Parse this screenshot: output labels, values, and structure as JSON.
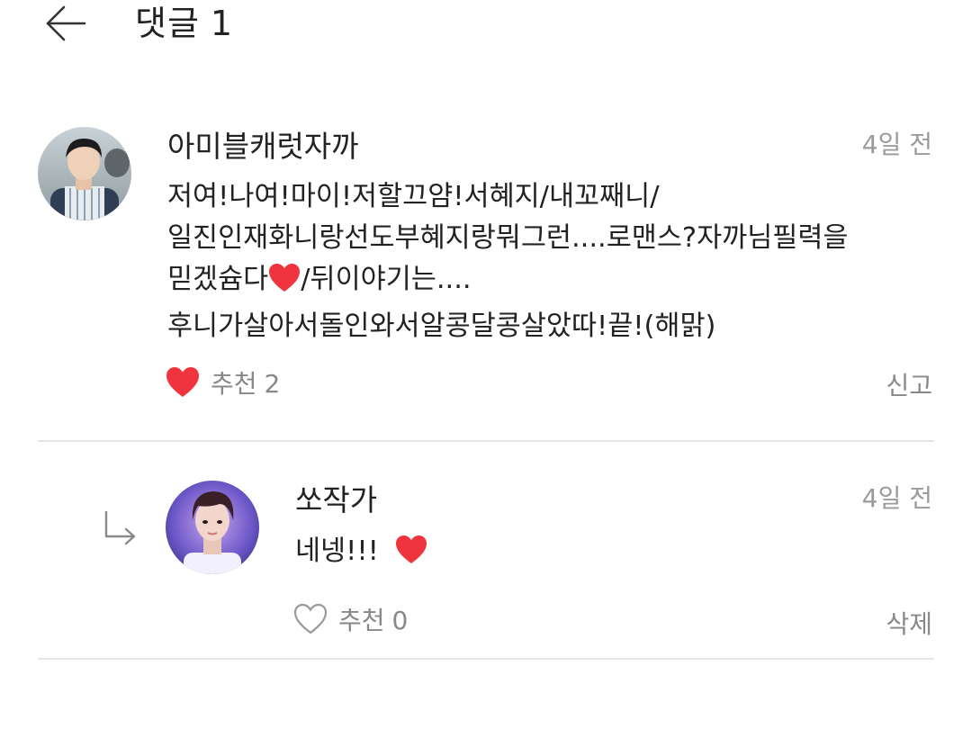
{
  "header": {
    "title": "댓글",
    "count": "1"
  },
  "comments": [
    {
      "author": "아미블캐럿자까",
      "time": "4일 전",
      "lines": [
        "저여!나여!마이!저할끄얌!서혜지/내꼬째니/",
        "일진인재화니랑선도부혜지랑뭐그런....로맨스?자까님필력을",
        "믿겠슘다",
        "/뒤이야기는....",
        "후니가살아서돌인와서알콩달콩살았따!끝!(해맑)"
      ],
      "like_label": "추천",
      "like_count": "2",
      "liked": true,
      "action": "신고"
    }
  ],
  "reply": {
    "author": "쏘작가",
    "time": "4일 전",
    "text": "네넹!!!",
    "like_label": "추천",
    "like_count": "0",
    "liked": false,
    "action": "삭제"
  },
  "colors": {
    "heart": "#f0343e",
    "muted": "#9a9a9a",
    "divider": "#e6e6e6"
  },
  "icons": {
    "back": "arrow-left-icon",
    "reply": "reply-arrow-icon",
    "like_filled": "heart-filled-icon",
    "like_outline": "heart-outline-icon"
  }
}
